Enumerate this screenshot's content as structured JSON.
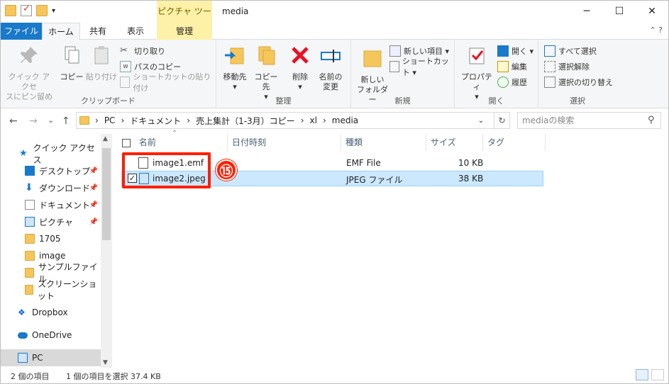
{
  "window": {
    "title": "media",
    "contextual_tab": "ピクチャ ツール",
    "buttons": {
      "minimize": "─",
      "maximize": "☐",
      "close": "✕"
    }
  },
  "ribbon_tabs": {
    "file": "ファイル",
    "home": "ホーム",
    "share": "共有",
    "view": "表示",
    "manage": "管理",
    "help": "⌃ ?"
  },
  "ribbon": {
    "clipboard": {
      "label": "クリップボード",
      "pin": [
        "クイック アクセ",
        "スにピン留め"
      ],
      "copy": "コピー",
      "paste": "貼り付け",
      "cut": "切り取り",
      "copy_path": "パスのコピー",
      "paste_shortcut": "ショートカットの貼り付け"
    },
    "organize": {
      "label": "整理",
      "move_to": "移動先",
      "copy_to": "コピー先",
      "delete": "削除",
      "rename": [
        "名前の",
        "変更"
      ]
    },
    "new": {
      "label": "新規",
      "new_folder": [
        "新しい",
        "フォルダー"
      ],
      "new_item": "新しい項目 ▾",
      "easy_access": "ショートカット ▾"
    },
    "open": {
      "label": "開く",
      "properties": "プロパティ",
      "open": "開く ▾",
      "edit": "編集",
      "history": "履歴"
    },
    "select": {
      "label": "選択",
      "select_all": "すべて選択",
      "select_none": "選択解除",
      "invert": "選択の切り替え"
    }
  },
  "address": {
    "back": "←",
    "forward": "→",
    "recent": "⌄",
    "up": "↑",
    "path": [
      "PC",
      "ドキュメント",
      "売上集計（1-3月）コピー",
      "xl",
      "media"
    ],
    "search_placeholder": "mediaの検索"
  },
  "nav": {
    "quick_access": "クイック アクセス",
    "items": [
      {
        "label": "デスクトップ",
        "pinned": true
      },
      {
        "label": "ダウンロード",
        "pinned": true
      },
      {
        "label": "ドキュメント",
        "pinned": true
      },
      {
        "label": "ピクチャ",
        "pinned": true
      },
      {
        "label": "1705",
        "pinned": false
      },
      {
        "label": "image",
        "pinned": false
      },
      {
        "label": "サンプルファイル",
        "pinned": false
      },
      {
        "label": "スクリーンショット",
        "pinned": false
      }
    ],
    "dropbox": "Dropbox",
    "onedrive": "OneDrive",
    "pc": "PC"
  },
  "list": {
    "columns": [
      "名前",
      "日付時刻",
      "種類",
      "サイズ",
      "タグ"
    ],
    "rows": [
      {
        "name": "image1.emf",
        "type": "EMF File",
        "size": "10 KB",
        "selected": false
      },
      {
        "name": "image2.jpeg",
        "type": "JPEG ファイル",
        "size": "38 KB",
        "selected": true
      }
    ],
    "callout_number": "⑮"
  },
  "status": {
    "count": "2 個の項目",
    "selected": "1 個の項目を選択  37.4 KB"
  },
  "colors": {
    "accent": "#1979ca",
    "callout": "#ff1e00",
    "selection": "#cce8ff"
  }
}
